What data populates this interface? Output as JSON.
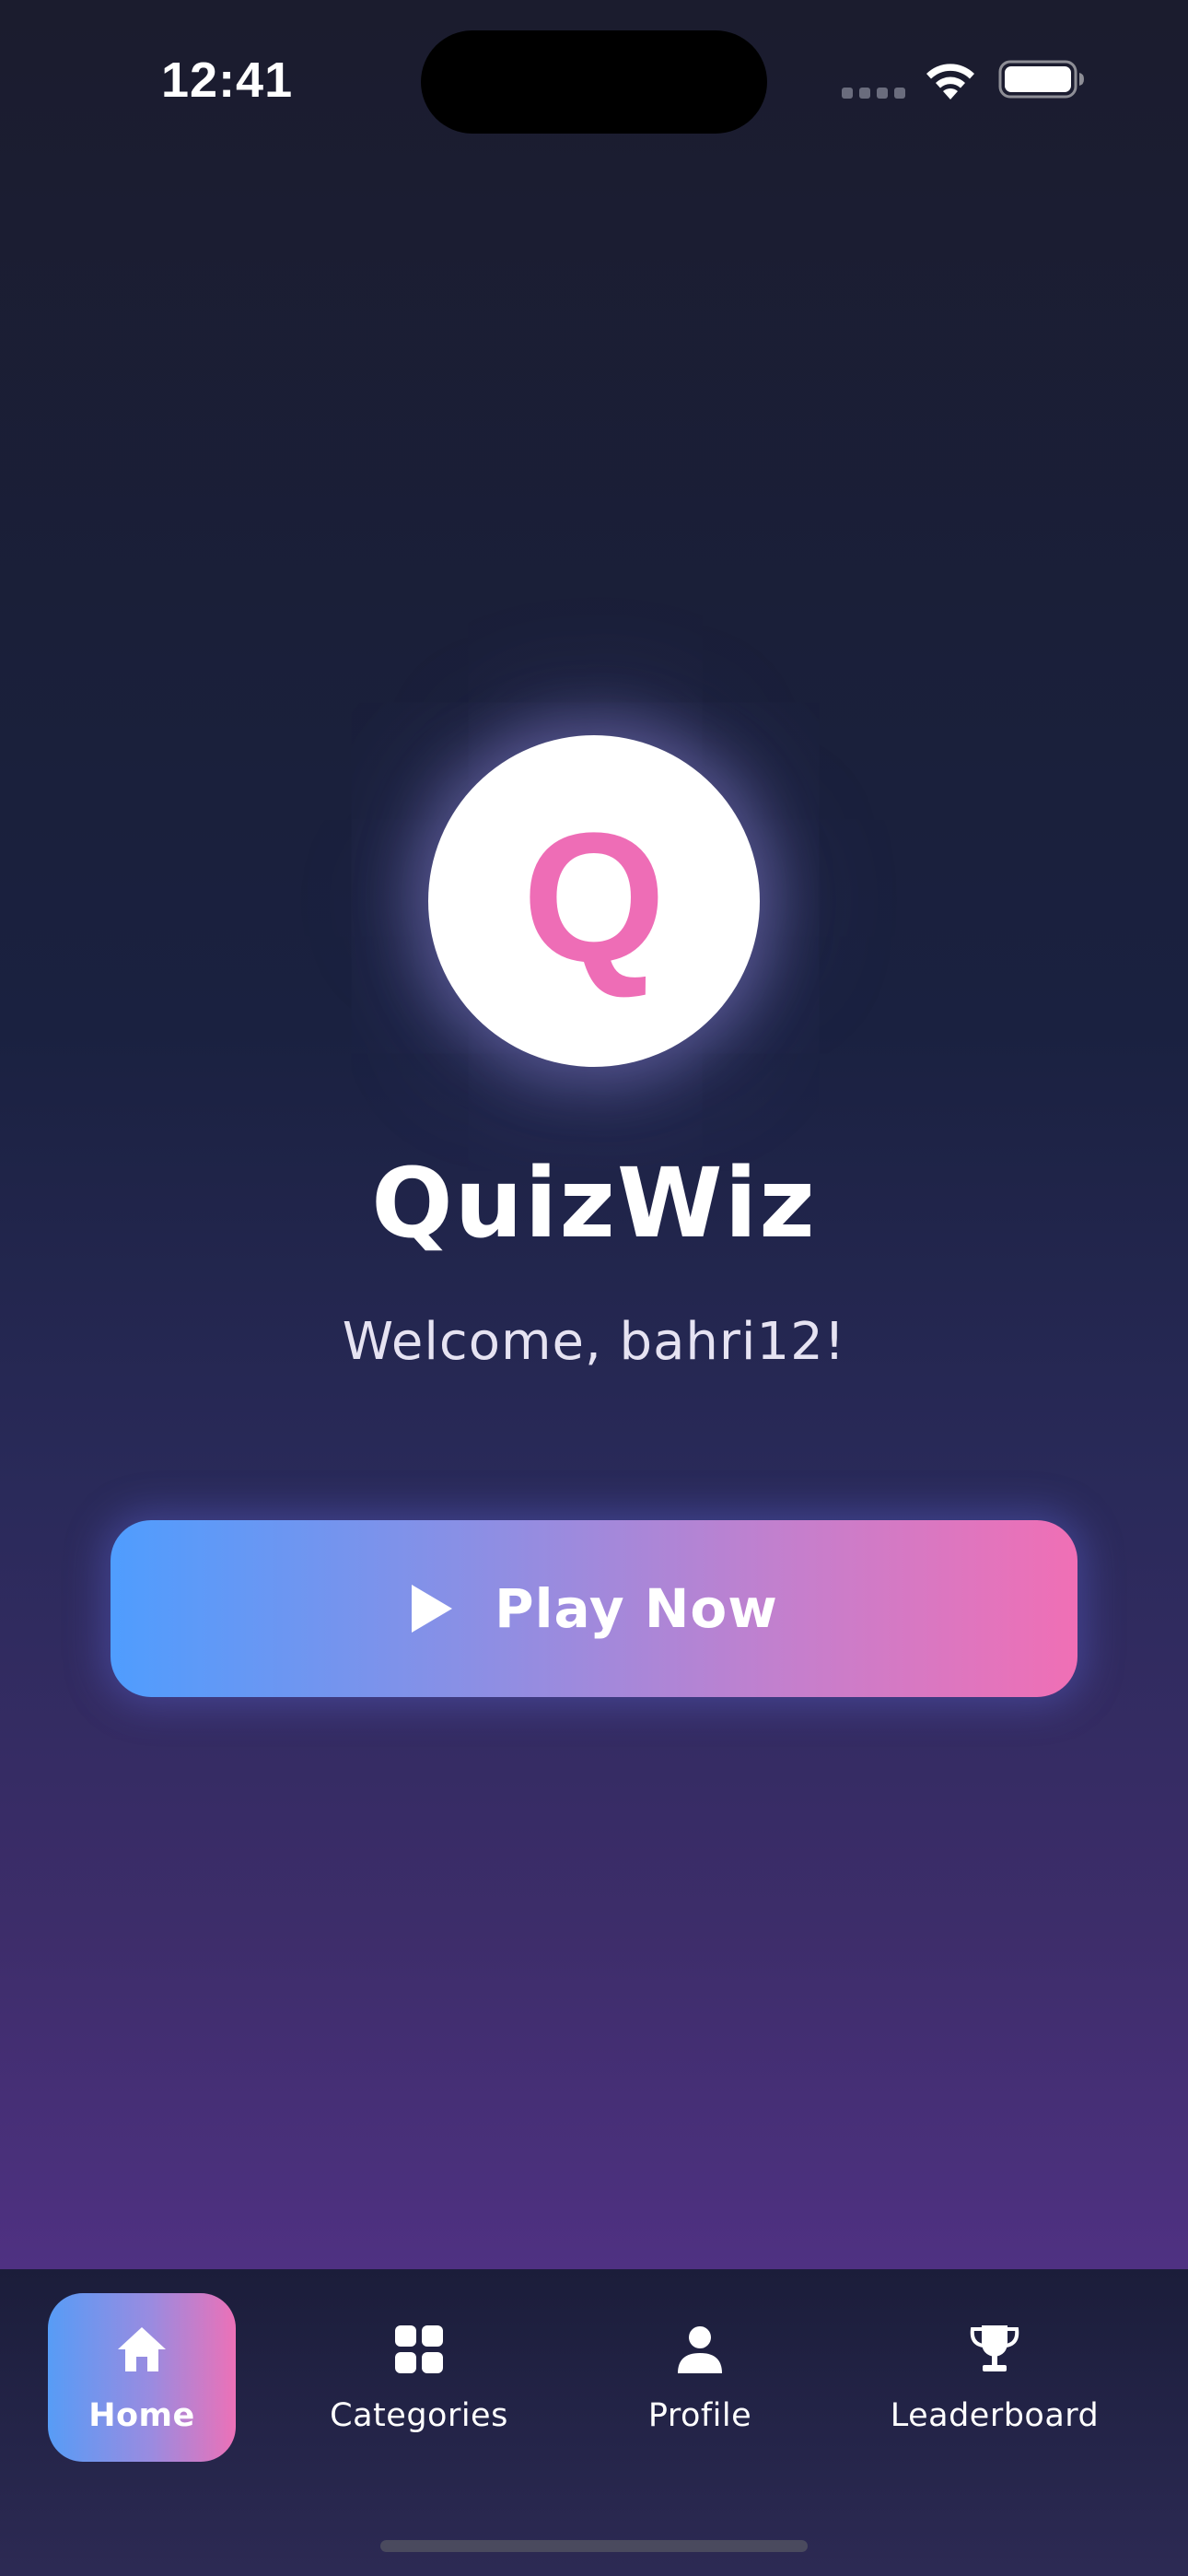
{
  "status_bar": {
    "time": "12:41"
  },
  "logo": {
    "letter": "Q",
    "color": "#ee6db6"
  },
  "app": {
    "title": "QuizWiz",
    "welcome": "Welcome, bahri12!"
  },
  "play_button": {
    "label": "Play Now",
    "gradient": [
      "#4f9dfe",
      "#f06fb5"
    ]
  },
  "bottom_nav": {
    "items": [
      {
        "label": "Home",
        "icon": "home-icon",
        "active": true
      },
      {
        "label": "Categories",
        "icon": "grid-icon",
        "active": false
      },
      {
        "label": "Profile",
        "icon": "person-icon",
        "active": false
      },
      {
        "label": "Leaderboard",
        "icon": "trophy-icon",
        "active": false
      }
    ]
  },
  "colors": {
    "accent_blue": "#4f9dfe",
    "accent_pink": "#f06fb5",
    "background_top": "#1b1c2e",
    "background_bottom": "#4f3182"
  }
}
